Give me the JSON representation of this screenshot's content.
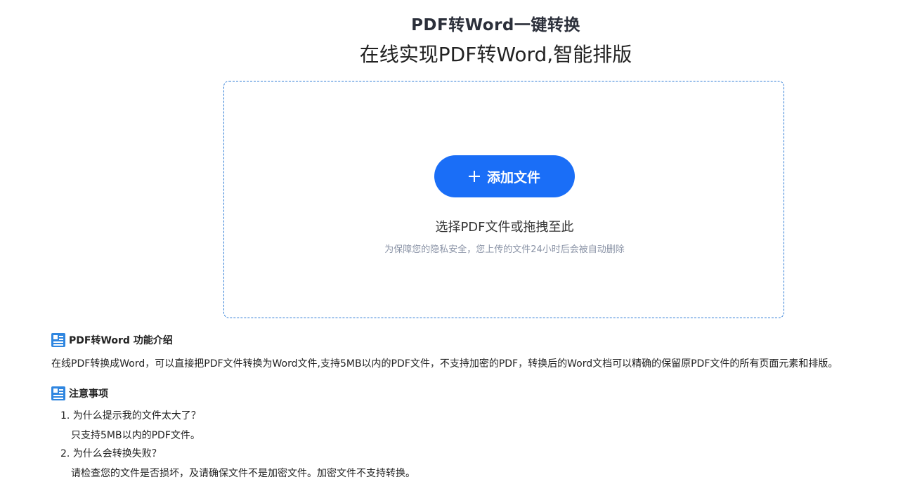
{
  "header": {
    "title": "PDF转Word一键转换",
    "subtitle": "在线实现PDF转Word,智能排版"
  },
  "upload": {
    "button_label": "添加文件",
    "drop_hint": "选择PDF文件或拖拽至此",
    "privacy_note": "为保障您的隐私安全，您上传的文件24小时后会被自动删除"
  },
  "intro": {
    "heading": "PDF转Word 功能介绍",
    "text": "在线PDF转换成Word，可以直接把PDF文件转换为Word文件,支持5MB以内的PDF文件，不支持加密的PDF，转换后的Word文档可以精确的保留原PDF文件的所有页面元素和排版。"
  },
  "notes": {
    "heading": "注意事项",
    "items": [
      {
        "question": "1. 为什么提示我的文件太大了？",
        "answer": "只支持5MB以内的PDF文件。"
      },
      {
        "question": "2. 为什么会转换失败？",
        "answer": "请检查您的文件是否损坏，及请确保文件不是加密文件。加密文件不支持转换。"
      }
    ]
  },
  "colors": {
    "accent": "#1a6ef7",
    "dropzone_border": "#2e7cd6",
    "icon": "#2f86e0",
    "muted_text": "#8a93a6"
  },
  "icons": [
    "plus-icon",
    "document-icon"
  ]
}
